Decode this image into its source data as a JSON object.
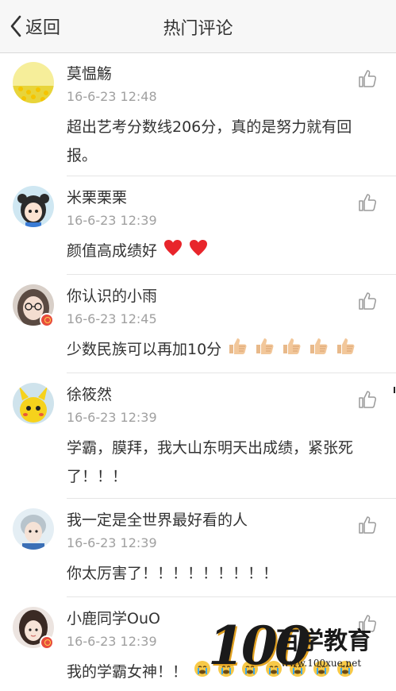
{
  "nav": {
    "back_label": "返回",
    "title": "热门评论"
  },
  "comments": [
    {
      "name": "莫愠觞",
      "time": "16-6-23 12:48",
      "text": "超出艺考分数线206分，真的是努力就有回报。",
      "emoji": []
    },
    {
      "name": "米栗栗栗",
      "time": "16-6-23 12:39",
      "text": "颜值高成绩好",
      "emoji": [
        "heart-emoji",
        "heart-emoji"
      ]
    },
    {
      "name": "你认识的小雨",
      "time": "16-6-23 12:45",
      "text": "少数民族可以再加10分",
      "emoji": [
        "thumbs-up-emoji",
        "thumbs-up-emoji",
        "thumbs-up-emoji",
        "thumbs-up-emoji",
        "thumbs-up-emoji"
      ]
    },
    {
      "name": "徐筱然",
      "time": "16-6-23 12:39",
      "text": "学霸，膜拜，我大山东明天出成绩，紧张死了！！！",
      "emoji": []
    },
    {
      "name": "我一定是全世界最好看的人",
      "time": "16-6-23 12:39",
      "text": "你太厉害了！！！！！！！！！",
      "emoji": []
    },
    {
      "name": "小鹿同学OuO",
      "time": "16-6-23 12:39",
      "text": "我的学霸女神！！",
      "emoji": [
        "crying-emoji",
        "crying-emoji",
        "crying-emoji",
        "crying-emoji",
        "crying-emoji",
        "crying-emoji",
        "crying-emoji"
      ]
    }
  ],
  "watermark": {
    "digits": "100",
    "brand": "百学教育",
    "url": "www.100xue.net"
  },
  "colors": {
    "nav_bg": "#f7f7f7",
    "text": "#333333",
    "time": "#a0a0a0",
    "divider": "#e5e5e5",
    "heart": "#e8252b",
    "thumb": "#f2c79a",
    "badge": "#e74c3c"
  }
}
